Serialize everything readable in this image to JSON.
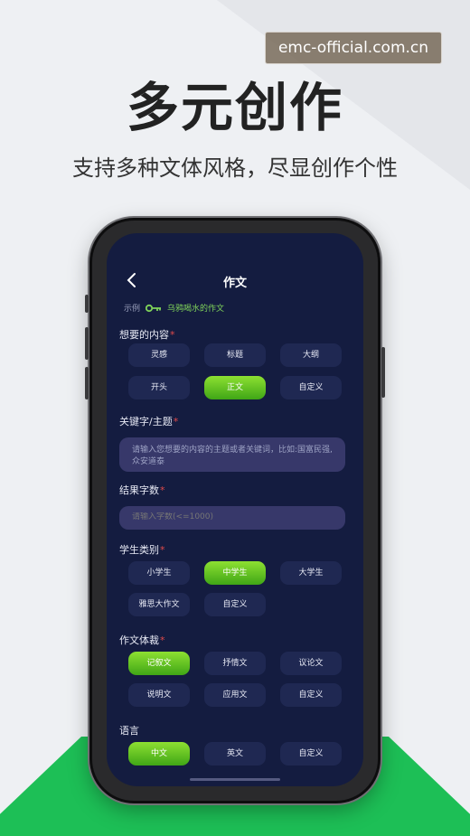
{
  "watermark": "emc-official.com.cn",
  "headline": "多元创作",
  "subline": "支持多种文体风格，尽显创作个性",
  "app": {
    "title": "作文",
    "example_label": "示例",
    "example_text": "乌鸦喝水的作文",
    "sections": {
      "content": {
        "label": "想要的内容",
        "options": [
          "灵感",
          "标题",
          "大纲",
          "开头",
          "正文",
          "自定义"
        ],
        "selected": "正文"
      },
      "keyword": {
        "label": "关键字/主题",
        "placeholder": "请输入您想要的内容的主题或者关键词，比如:国富民强,众安道泰"
      },
      "word_count": {
        "label": "结果字数",
        "placeholder": "请输入字数(<=1000)"
      },
      "student": {
        "label": "学生类别",
        "options": [
          "小学生",
          "中学生",
          "大学生",
          "雅思大作文",
          "自定义"
        ],
        "selected": "中学生"
      },
      "genre": {
        "label": "作文体裁",
        "options": [
          "记叙文",
          "抒情文",
          "议论文",
          "说明文",
          "应用文",
          "自定义"
        ],
        "selected": "记叙文"
      },
      "language": {
        "label": "语言",
        "options": [
          "中文",
          "英文",
          "自定义"
        ],
        "selected": "中文"
      }
    }
  },
  "colors": {
    "screen_bg": "#141c40",
    "chip_bg": "#1f2852",
    "accent_green": "#5cc321",
    "required": "#e04a4a",
    "banner_green": "#1dbf56"
  }
}
